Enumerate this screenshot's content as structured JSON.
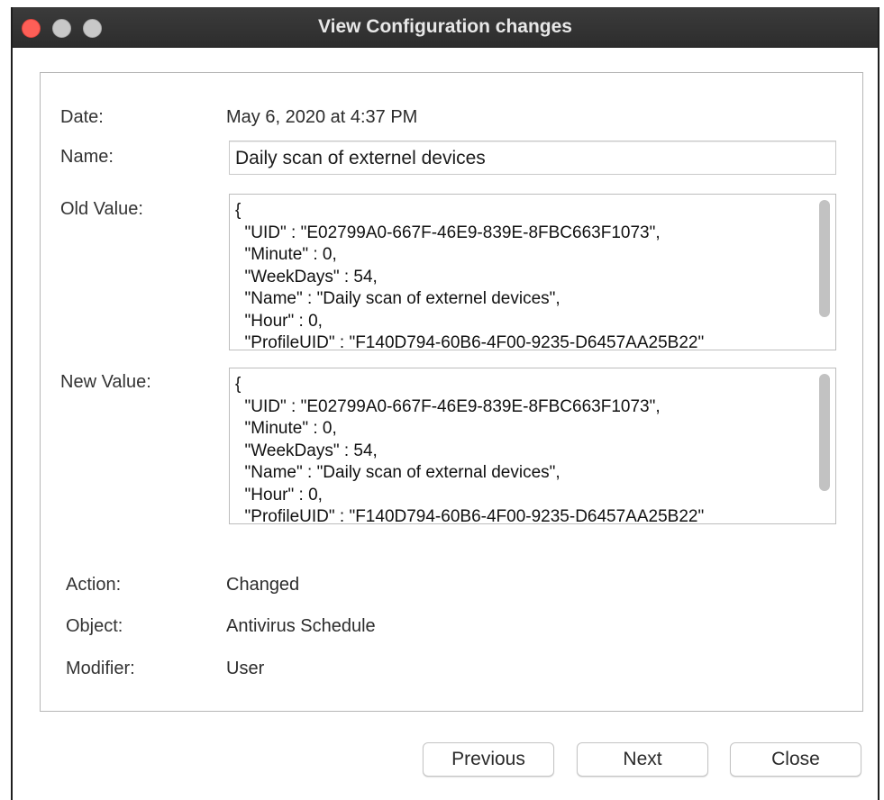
{
  "window": {
    "title": "View Configuration changes"
  },
  "fields": {
    "date_label": "Date:",
    "date_value": "May 6, 2020 at 4:37 PM",
    "name_label": "Name:",
    "name_value": "Daily scan of externel devices",
    "old_value_label": "Old Value:",
    "old_value_text": "{\n  \"UID\" : \"E02799A0-667F-46E9-839E-8FBC663F1073\",\n  \"Minute\" : 0,\n  \"WeekDays\" : 54,\n  \"Name\" : \"Daily scan of externel devices\",\n  \"Hour\" : 0,\n  \"ProfileUID\" : \"F140D794-60B6-4F00-9235-D6457AA25B22\"",
    "new_value_label": "New Value:",
    "new_value_text": "{\n  \"UID\" : \"E02799A0-667F-46E9-839E-8FBC663F1073\",\n  \"Minute\" : 0,\n  \"WeekDays\" : 54,\n  \"Name\" : \"Daily scan of external devices\",\n  \"Hour\" : 0,\n  \"ProfileUID\" : \"F140D794-60B6-4F00-9235-D6457AA25B22\"",
    "action_label": "Action:",
    "action_value": "Changed",
    "object_label": "Object:",
    "object_value": "Antivirus Schedule",
    "modifier_label": "Modifier:",
    "modifier_value": "User"
  },
  "buttons": {
    "previous": "Previous",
    "next": "Next",
    "close": "Close"
  },
  "colors": {
    "titlebar": "#2d2d2d",
    "close_light": "#fe5f57",
    "inactive_light": "#c8c8c8"
  }
}
